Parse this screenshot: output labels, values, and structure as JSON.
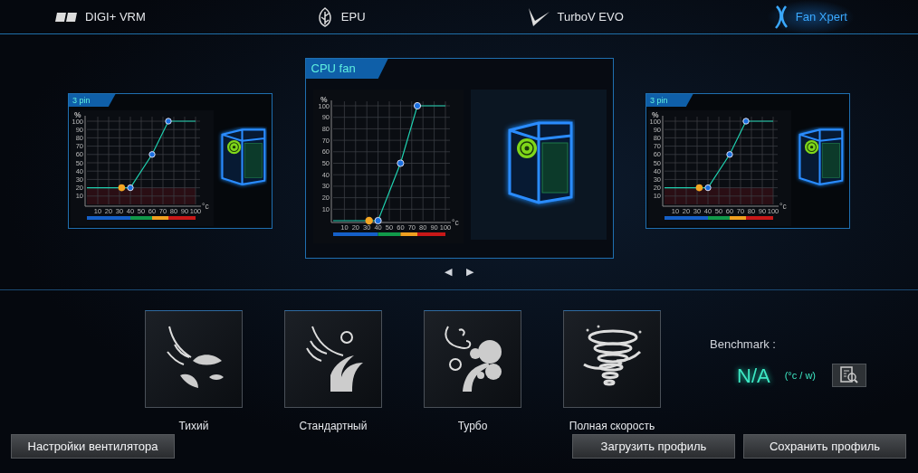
{
  "tabs": [
    {
      "label": "DIGI+ VRM",
      "selected": false
    },
    {
      "label": "EPU",
      "selected": false
    },
    {
      "label": "TurboV EVO",
      "selected": false
    },
    {
      "label": "Fan Xpert",
      "selected": true
    }
  ],
  "fans": [
    {
      "title": "3 pin",
      "selected": false,
      "chart_data": {
        "type": "line",
        "ylabel": "%",
        "xlabel": "°c",
        "grid": true,
        "x": [
          0,
          32,
          40,
          60,
          75,
          100
        ],
        "xticks": [
          10,
          20,
          30,
          40,
          50,
          60,
          70,
          80,
          90,
          100
        ],
        "yticks": [
          10,
          20,
          30,
          40,
          50,
          60,
          70,
          80,
          90,
          100
        ],
        "xlim": [
          0,
          100
        ],
        "ylim": [
          0,
          100
        ],
        "bands": [
          {
            "axis": "y",
            "from": 0,
            "to": 20,
            "color": "#2a0e14"
          }
        ],
        "series": [
          {
            "color": "#1fd1b0",
            "values": [
              20,
              20,
              20,
              60,
              100,
              100
            ]
          },
          {
            "color": "#f5a623",
            "marker": true,
            "values": [
              null,
              20,
              null,
              null,
              null,
              null
            ]
          }
        ]
      }
    },
    {
      "title": "CPU fan",
      "selected": true,
      "chart_data": {
        "type": "line",
        "ylabel": "%",
        "xlabel": "°c",
        "grid": true,
        "x": [
          0,
          32,
          40,
          60,
          75,
          100
        ],
        "xticks": [
          10,
          20,
          30,
          40,
          50,
          60,
          70,
          80,
          90,
          100
        ],
        "yticks": [
          10,
          20,
          30,
          40,
          50,
          60,
          70,
          80,
          90,
          100
        ],
        "xlim": [
          0,
          100
        ],
        "ylim": [
          0,
          100
        ],
        "series": [
          {
            "color": "#1fd1b0",
            "values": [
              0,
              0,
              0,
              50,
              100,
              100
            ]
          },
          {
            "color": "#f5a623",
            "marker": true,
            "values": [
              null,
              0,
              null,
              null,
              null,
              null
            ]
          }
        ]
      }
    },
    {
      "title": "3 pin",
      "selected": false,
      "chart_data": {
        "type": "line",
        "ylabel": "%",
        "xlabel": "°c",
        "grid": true,
        "x": [
          0,
          32,
          40,
          60,
          75,
          100
        ],
        "xticks": [
          10,
          20,
          30,
          40,
          50,
          60,
          70,
          80,
          90,
          100
        ],
        "yticks": [
          10,
          20,
          30,
          40,
          50,
          60,
          70,
          80,
          90,
          100
        ],
        "xlim": [
          0,
          100
        ],
        "ylim": [
          0,
          100
        ],
        "bands": [
          {
            "axis": "y",
            "from": 0,
            "to": 20,
            "color": "#2a0e14"
          }
        ],
        "series": [
          {
            "color": "#1fd1b0",
            "values": [
              20,
              20,
              20,
              60,
              100,
              100
            ]
          },
          {
            "color": "#f5a623",
            "marker": true,
            "values": [
              null,
              20,
              null,
              null,
              null,
              null
            ]
          }
        ]
      }
    }
  ],
  "pager": {
    "prev": "◀",
    "next": "▶"
  },
  "modes": [
    {
      "label": "Тихий"
    },
    {
      "label": "Стандартный"
    },
    {
      "label": "Турбо"
    },
    {
      "label": "Полная скорость"
    }
  ],
  "benchmark": {
    "label": "Benchmark :",
    "value": "N/A",
    "unit": "(°c / w)"
  },
  "buttons": {
    "settings": "Настройки вентилятора",
    "load": "Загрузить профиль",
    "save": "Сохранить профиль"
  }
}
